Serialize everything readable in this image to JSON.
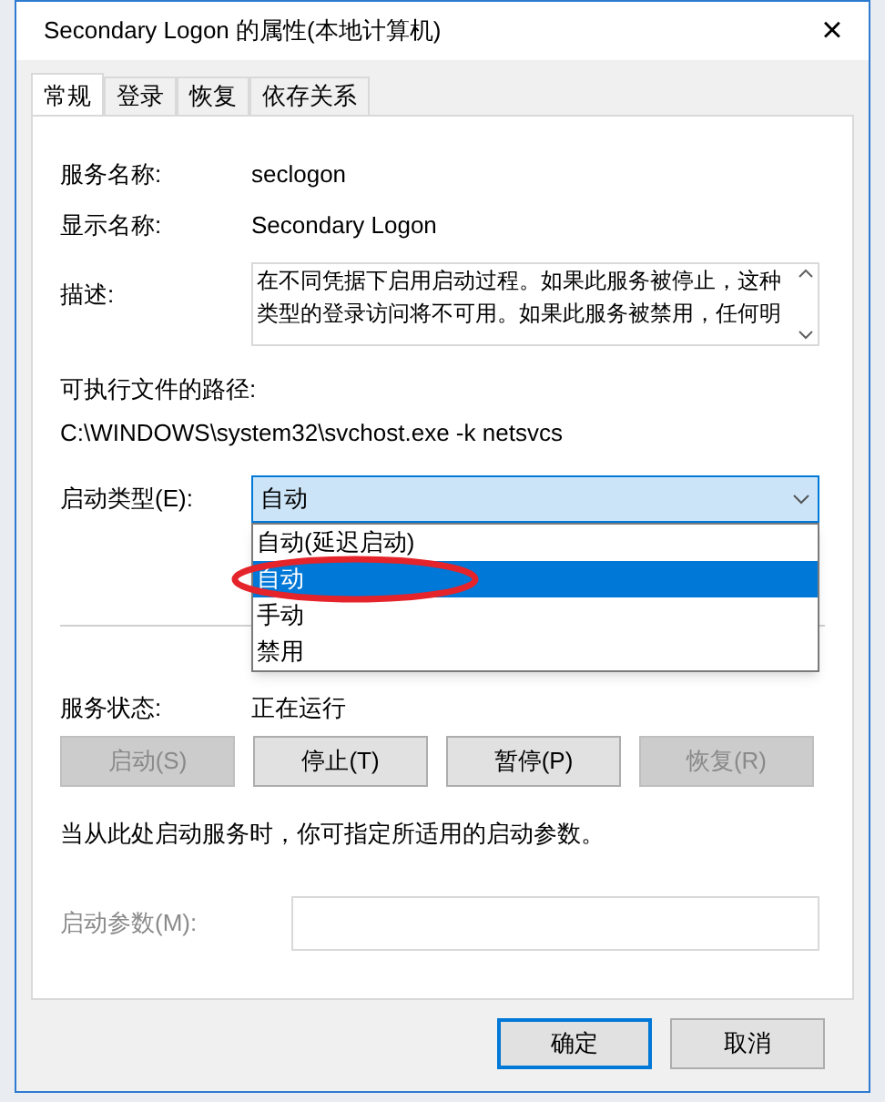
{
  "window": {
    "title": "Secondary Logon 的属性(本地计算机)",
    "close": "×"
  },
  "tabs": [
    {
      "label": "常规",
      "selected": true
    },
    {
      "label": "登录",
      "selected": false
    },
    {
      "label": "恢复",
      "selected": false
    },
    {
      "label": "依存关系",
      "selected": false
    }
  ],
  "fields": [
    {
      "label": "服务名称:",
      "value": "seclogon"
    },
    {
      "label": "显示名称:",
      "value": "Secondary Logon"
    }
  ],
  "description": {
    "label": "描述:",
    "text": "在不同凭据下启用启动过程。如果此服务被停止，这种类型的登录访问将不可用。如果此服务被禁用，任何明"
  },
  "path": {
    "label": "可执行文件的路径:",
    "value": "C:\\WINDOWS\\system32\\svchost.exe -k netsvcs"
  },
  "startup_type": {
    "label": "启动类型(E):",
    "value": "自动",
    "expanded": true,
    "options": [
      {
        "label": "自动(延迟启动)",
        "selected": false
      },
      {
        "label": "自动",
        "selected": true
      },
      {
        "label": "手动",
        "selected": false
      },
      {
        "label": "禁用",
        "selected": false
      }
    ]
  },
  "annotation": {
    "kind": "circle"
  },
  "status": {
    "label": "服务状态:",
    "value": "正在运行"
  },
  "service_buttons": [
    {
      "label": "启动(S)",
      "disabled": true
    },
    {
      "label": "停止(T)",
      "disabled": false
    },
    {
      "label": "暂停(P)",
      "disabled": false
    },
    {
      "label": "恢复(R)",
      "disabled": true
    }
  ],
  "hint": "当从此处启动服务时，你可指定所适用的启动参数。",
  "start_params": {
    "label": "启动参数(M):",
    "disabled": true
  },
  "dialog_buttons": [
    {
      "label": "确定",
      "selected": true
    },
    {
      "label": "取消",
      "selected": false
    }
  ]
}
